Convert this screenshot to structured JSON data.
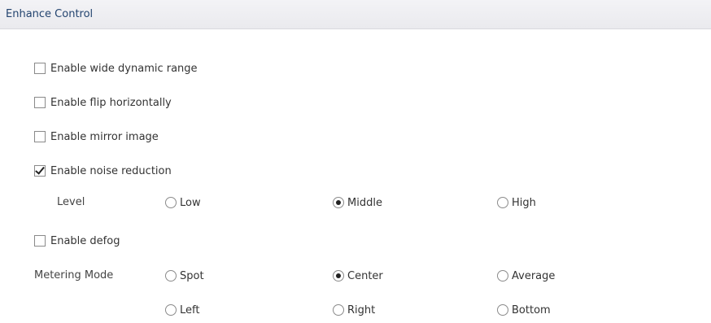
{
  "header": {
    "title": "Enhance Control"
  },
  "options": {
    "wide_dynamic_range": {
      "label": "Enable wide dynamic range",
      "checked": false
    },
    "flip_horizontally": {
      "label": "Enable flip horizontally",
      "checked": false
    },
    "mirror_image": {
      "label": "Enable mirror image",
      "checked": false
    },
    "noise_reduction": {
      "label": "Enable noise reduction",
      "checked": true
    },
    "defog": {
      "label": "Enable defog",
      "checked": false
    }
  },
  "noise_level": {
    "label": "Level",
    "options": [
      "Low",
      "Middle",
      "High"
    ],
    "selected": "Middle"
  },
  "metering_mode": {
    "label": "Metering Mode",
    "options": [
      "Spot",
      "Center",
      "Average",
      "Left",
      "Right",
      "Bottom"
    ],
    "selected": "Center"
  }
}
